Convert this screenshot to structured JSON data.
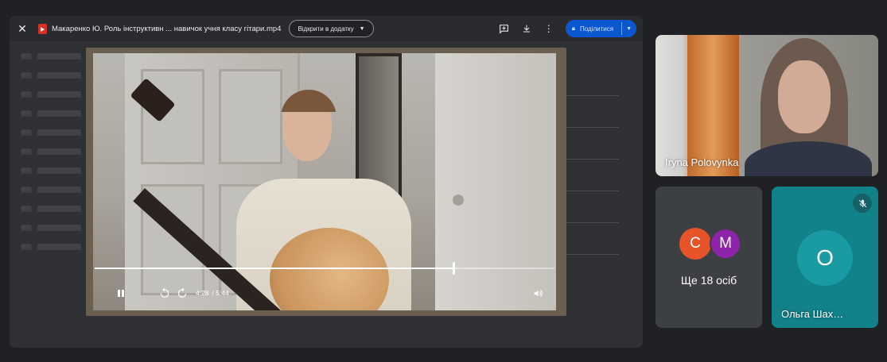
{
  "viewer": {
    "file_title": "Макаренко Ю. Роль інструктивн ... навичок учня класу гітари.mp4",
    "open_with_label": "Відкрити в додатку",
    "share_label": "Поділитися",
    "icons": [
      "close-icon",
      "video-file-icon",
      "add-comment-icon",
      "download-icon",
      "more-vert-icon",
      "lock-icon",
      "caret-down-icon"
    ]
  },
  "player": {
    "current_time": "4:28",
    "duration": "/ 5:44",
    "progress": 0.78,
    "icons": [
      "pause-icon",
      "rewind-10-icon",
      "forward-10-icon",
      "volume-icon"
    ]
  },
  "participants": {
    "main_cam_name": "Iryna Polovynka",
    "more_label": "Ще 18 осіб",
    "more_avatars": [
      {
        "initial": "C",
        "color": "#e8542a"
      },
      {
        "initial": "M",
        "color": "#8e24aa"
      }
    ],
    "olga_initial": "O",
    "olga_name": "Ольга Шах…",
    "olga_tile_color": "#12828a"
  }
}
